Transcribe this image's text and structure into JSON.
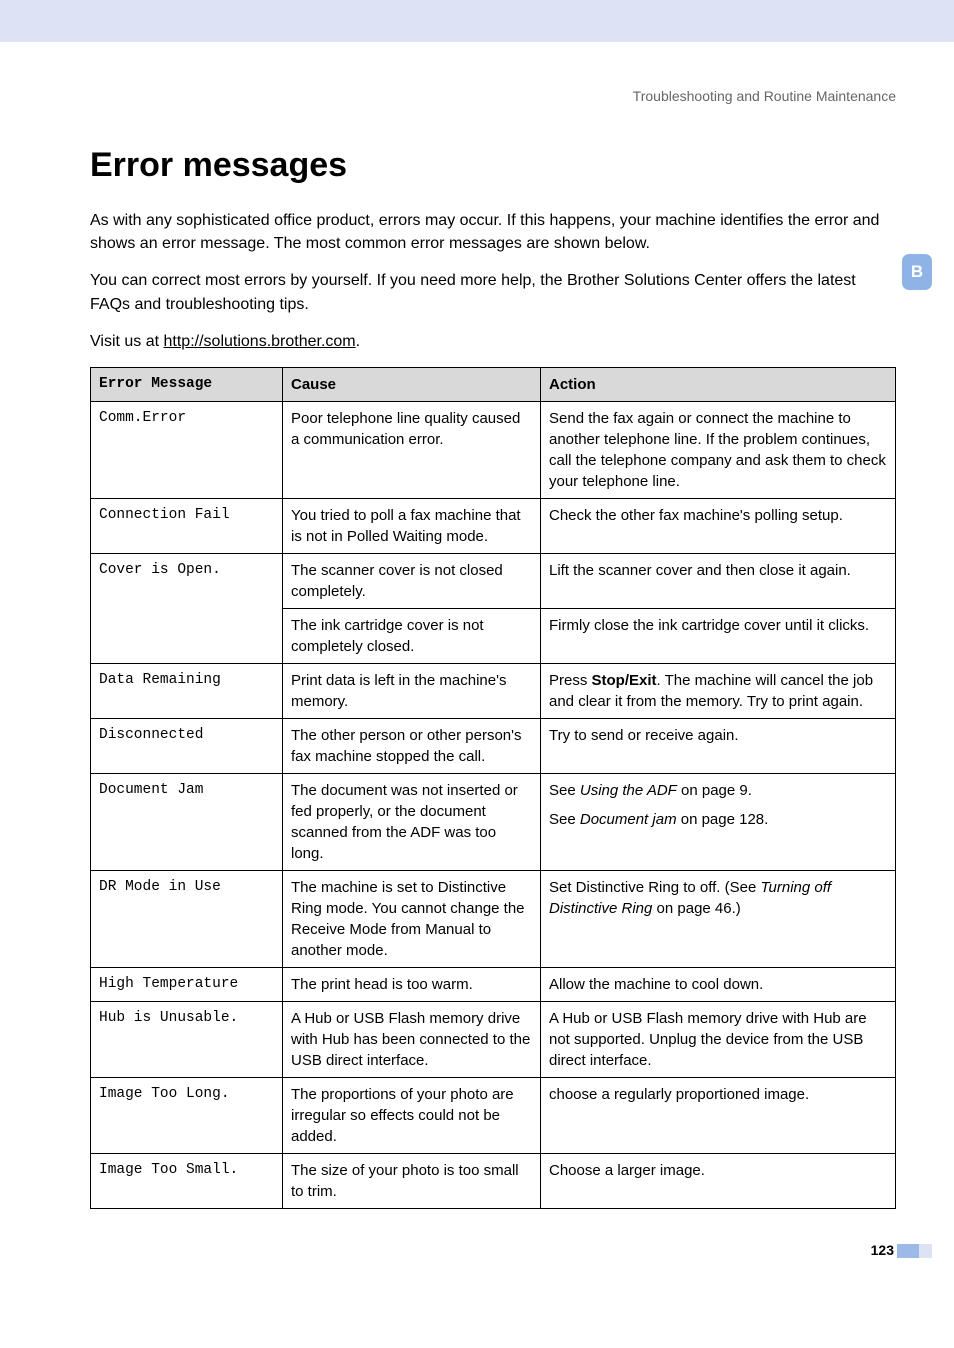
{
  "breadcrumb": "Troubleshooting and Routine Maintenance",
  "page_title": "Error messages",
  "side_tab": "B",
  "intro": {
    "p1": "As with any sophisticated office product, errors may occur. If this happens, your machine identifies the error and shows an error message. The most common error messages are shown below.",
    "p2": "You can correct most errors by yourself. If you need more help, the Brother Solutions Center offers the latest FAQs and troubleshooting tips.",
    "p3_prefix": "Visit us at ",
    "p3_link": "http://solutions.brother.com",
    "p3_suffix": "."
  },
  "table": {
    "headers": {
      "error": "Error Message",
      "cause": "Cause",
      "action": "Action"
    },
    "rows": [
      {
        "error": "Comm.Error",
        "cause": "Poor telephone line quality caused a communication error.",
        "action": "Send the fax again or connect the machine to another telephone line. If the problem continues, call the telephone company and ask them to check your telephone line."
      },
      {
        "error": "Connection Fail",
        "cause": "You tried to poll a fax machine that is not in Polled Waiting mode.",
        "action": "Check the other fax machine's polling setup."
      },
      {
        "error": "Cover is Open.",
        "cause": "The scanner cover is not closed completely.",
        "action": "Lift the scanner cover and then close it again.",
        "rowspan_error": 2
      },
      {
        "cause": "The ink cartridge cover is not completely closed.",
        "action": "Firmly close the ink cartridge cover until it clicks."
      },
      {
        "error": "Data Remaining",
        "cause": "Print data is left in the machine's memory.",
        "action_pre": "Press ",
        "action_bold": "Stop/Exit",
        "action_post": ". The machine will cancel the job and clear it from the memory. Try to print again."
      },
      {
        "error": "Disconnected",
        "cause": "The other person or other person's fax machine stopped the call.",
        "action": "Try to send or receive again."
      },
      {
        "error": "Document Jam",
        "cause": "The document was not inserted or fed properly, or the document scanned from the ADF was too long.",
        "action_l1_pre": "See ",
        "action_l1_italic": "Using the ADF",
        "action_l1_post": " on page 9.",
        "action_l2_pre": "See ",
        "action_l2_italic": "Document jam",
        "action_l2_post": " on page 128."
      },
      {
        "error": "DR Mode in Use",
        "cause": "The machine is set to Distinctive Ring mode. You cannot change the Receive Mode from Manual to another mode.",
        "action_pre": "Set Distinctive Ring to off. (See ",
        "action_italic": "Turning off Distinctive Ring",
        "action_post": " on page 46.)"
      },
      {
        "error": "High Temperature",
        "cause": "The print head is too warm.",
        "action": "Allow the machine to cool down."
      },
      {
        "error": "Hub is Unusable.",
        "cause": "A Hub or USB Flash memory drive with Hub has been connected to the USB direct interface.",
        "action": "A Hub or USB Flash memory drive with Hub are not supported. Unplug the device from the USB direct interface."
      },
      {
        "error": "Image Too Long.",
        "cause": "The proportions of your photo are irregular so effects could not be added.",
        "action": "choose a regularly proportioned image."
      },
      {
        "error": "Image Too Small.",
        "cause": "The size of your photo is too small to trim.",
        "action": "Choose a larger image."
      }
    ]
  },
  "page_number": "123"
}
